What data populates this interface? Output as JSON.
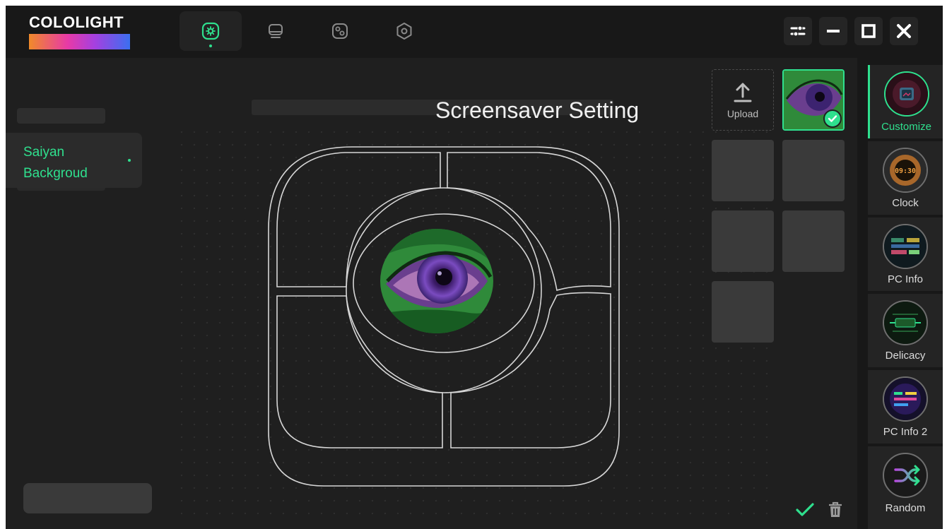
{
  "app": {
    "logo_text": "COLOLIGHT"
  },
  "nav": {
    "tabs": [
      {
        "icon": "display-effect-icon",
        "active": true
      },
      {
        "icon": "monitor-icon",
        "active": false
      },
      {
        "icon": "widgets-icon",
        "active": false
      },
      {
        "icon": "hexagon-settings-icon",
        "active": false
      }
    ]
  },
  "window_controls": [
    "settings-sliders-icon",
    "minimize-icon",
    "maximize-icon",
    "close-icon"
  ],
  "left_panel": {
    "selected_background": "Saiyan Backgroud"
  },
  "main": {
    "title": "Screensaver Setting"
  },
  "gallery": {
    "upload_label": "Upload",
    "selected_index": 0,
    "empty_slots": 5
  },
  "sidebar": {
    "items": [
      {
        "label": "Customize",
        "active": true
      },
      {
        "label": "Clock",
        "active": false
      },
      {
        "label": "PC Info",
        "active": false
      },
      {
        "label": "Delicacy",
        "active": false
      },
      {
        "label": "PC Info 2",
        "active": false
      },
      {
        "label": "Random",
        "active": false
      }
    ]
  },
  "colors": {
    "accent": "#2fe08e",
    "background": "#1f1f1f",
    "topbar": "#181818"
  }
}
